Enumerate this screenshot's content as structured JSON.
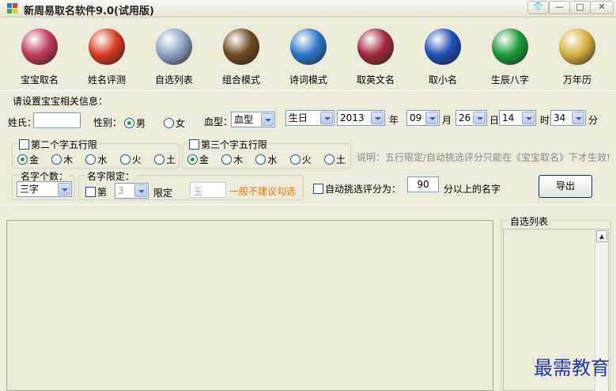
{
  "window": {
    "title": "新周易取名软件9.0(试用版)"
  },
  "toolbar": [
    {
      "id": "baby",
      "label": "宝宝取名",
      "icon": "baby-naming-icon",
      "color": "#c23a5e"
    },
    {
      "id": "eval",
      "label": "姓名评测",
      "icon": "name-evaluation-icon",
      "color": "#d83a1e"
    },
    {
      "id": "list",
      "label": "自选列表",
      "icon": "brushes-icon",
      "color": "#8aa3c4"
    },
    {
      "id": "combo",
      "label": "组合模式",
      "icon": "combination-icon",
      "color": "#6d4a1f"
    },
    {
      "id": "poem",
      "label": "诗词模式",
      "icon": "poem-book-icon",
      "color": "#2b78c8"
    },
    {
      "id": "english",
      "label": "取英文名",
      "icon": "barcelona-badge-icon",
      "color": "#a3273c"
    },
    {
      "id": "nick",
      "label": "取小名",
      "icon": "phoenix-icon",
      "color": "#1d4fb8"
    },
    {
      "id": "bazi",
      "label": "生辰八字",
      "icon": "bagua-icon",
      "color": "#1b9b35"
    },
    {
      "id": "calendar",
      "label": "万年历",
      "icon": "clock-calendar-icon",
      "color": "#d8b03a"
    }
  ],
  "form": {
    "section_title": "请设置宝宝相关信息：",
    "surname_label": "姓氏：",
    "surname_value": "",
    "gender_label": "性别：",
    "gender_male": "男",
    "gender_female": "女",
    "blood_label": "血型：",
    "blood_value": "血型",
    "birthday_value": "生日",
    "year_value": "2013",
    "year_unit": "年",
    "month_value": "09",
    "month_unit": "月",
    "day_value": "26",
    "day_unit": "日",
    "hour_value": "14",
    "hour_unit": "时",
    "minute_value": "34",
    "minute_unit": "分"
  },
  "wuxing": {
    "second_label": "第二个字五行限",
    "third_label": "第三个字五行限",
    "elements": [
      "金",
      "木",
      "水",
      "火",
      "土"
    ],
    "note": "说明：五行限定/自动挑选评分只能在《宝宝取名》下才生效!"
  },
  "options": {
    "count_title": "名字个数：",
    "count_value": "三字",
    "limit_title": "名字限定：",
    "limit_prefix": "第",
    "limit_index": "3",
    "limit_label": "限定",
    "limit_char_placeholder": "玉",
    "limit_hint": "一般不建议勾选",
    "auto_label": "自动挑选评分为：",
    "auto_score": "90",
    "auto_suffix": "分以上的名字",
    "export_label": "导出"
  },
  "side": {
    "title": "自选列表"
  },
  "watermark": "最需教育",
  "colors": {
    "hint": "#e07b00",
    "note": "#8a8a8a",
    "watermark": "#1f3aa8"
  }
}
